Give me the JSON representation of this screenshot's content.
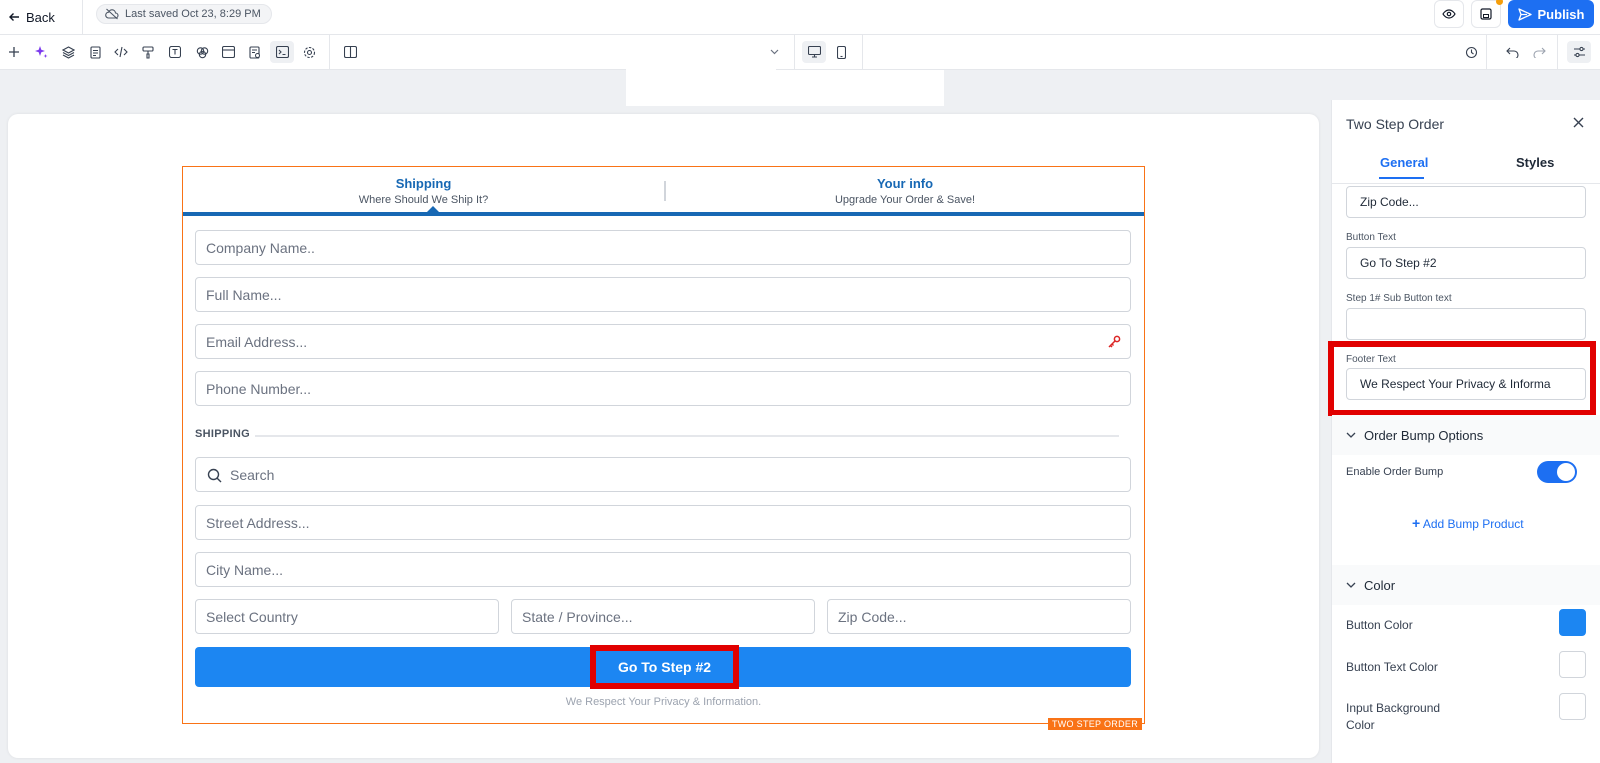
{
  "topbar": {
    "back_label": "Back",
    "last_saved": "Last saved Oct 23, 8:29 PM",
    "publish_label": "Publish"
  },
  "toolbar": {
    "icons": [
      "plus-icon",
      "sparkle-icon",
      "layers-icon",
      "page-icon",
      "code-icon",
      "paint-roller-icon",
      "text-icon",
      "palette-icon",
      "browser-icon",
      "form-icon",
      "terminal-icon",
      "settings-cog-icon",
      "split-view-icon"
    ],
    "active_icon": "terminal-icon"
  },
  "form": {
    "tabs": [
      {
        "title": "Shipping",
        "subtitle": "Where Should We Ship It?"
      },
      {
        "title": "Your info",
        "subtitle": "Upgrade Your Order & Save!"
      }
    ],
    "fields": {
      "company": "Company Name..",
      "full_name": "Full Name...",
      "email": "Email Address...",
      "phone": "Phone Number...",
      "search": "Search",
      "street": "Street Address...",
      "city": "City Name...",
      "country": "Select Country",
      "state": "State / Province...",
      "zip": "Zip Code..."
    },
    "shipping_label": "SHIPPING",
    "button_text": "Go To Step #2",
    "footer_text": "We Respect Your Privacy & Information.",
    "element_tag": "TWO STEP ORDER"
  },
  "panel": {
    "title": "Two Step Order",
    "tabs": [
      "General",
      "Styles"
    ],
    "active_tab": "General",
    "zip_value": "Zip Code...",
    "button_text_label": "Button Text",
    "button_text_value": "Go To Step #2",
    "sub_button_label": "Step 1# Sub Button text",
    "sub_button_value": "",
    "footer_text_label": "Footer Text",
    "footer_text_value": "We Respect Your Privacy & Informa",
    "order_bump_section": "Order Bump Options",
    "enable_order_bump_label": "Enable Order Bump",
    "enable_order_bump": true,
    "add_bump_label": "Add Bump Product",
    "color_section": "Color",
    "colors": [
      {
        "label": "Button Color",
        "value": "#1c86f2"
      },
      {
        "label": "Button Text Color",
        "value": "#ffffff"
      },
      {
        "label": "Input Background Color",
        "value": "#ffffff"
      }
    ]
  },
  "theme": {
    "accent": "#1d6ff2",
    "step_blue": "#1768b4",
    "element_outline": "#f97316",
    "highlight_red": "#e10000"
  }
}
